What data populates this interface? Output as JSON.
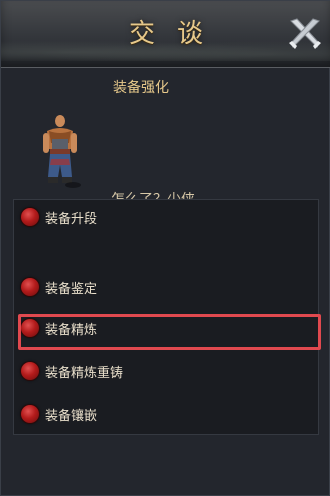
{
  "window": {
    "title": "交谈"
  },
  "npc": {
    "name": "装备强化",
    "greeting": "怎么了？少侠"
  },
  "options": [
    {
      "label": "装备升段"
    },
    {
      "label": "装备鉴定"
    },
    {
      "label": "装备精炼"
    },
    {
      "label": "装备精炼重铸"
    },
    {
      "label": "装备镶嵌"
    }
  ],
  "colors": {
    "title_gold": "#e7c98b",
    "bullet_red": "#b31b1b",
    "highlight_red": "#e0494f"
  },
  "icons": {
    "close": "close-x-icon",
    "bullet": "red-orb-icon"
  }
}
